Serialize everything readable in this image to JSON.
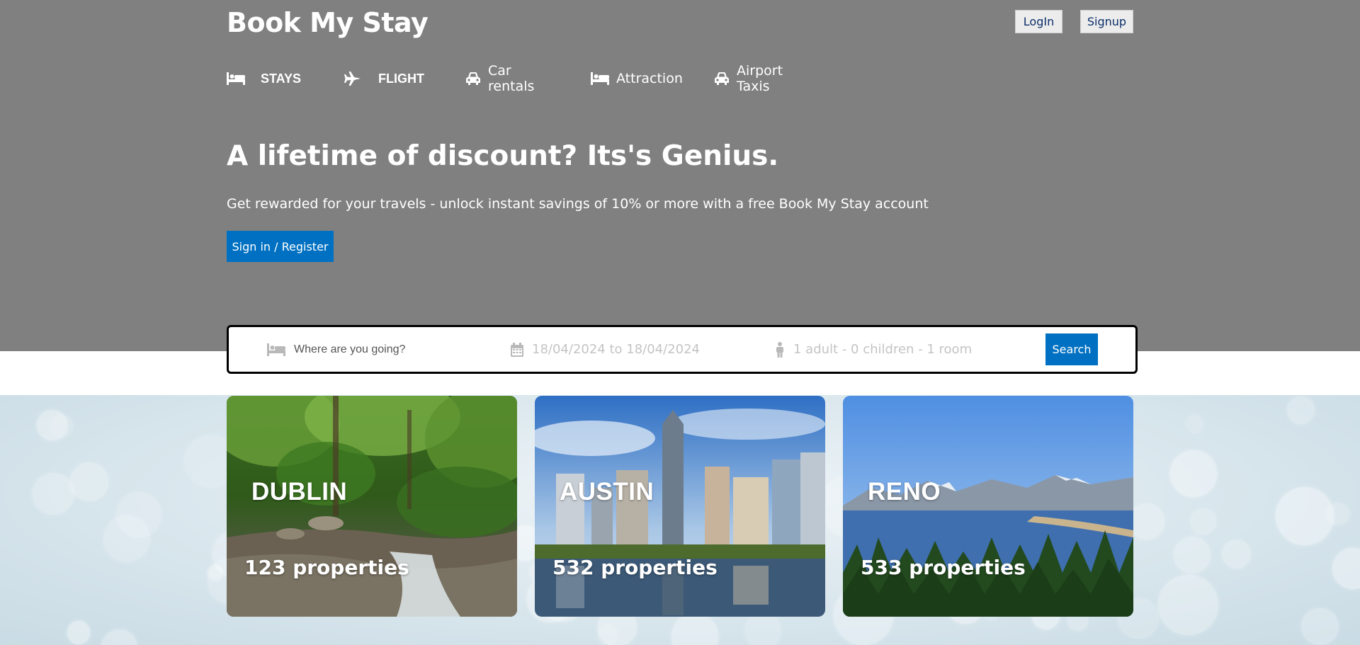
{
  "brand": {
    "name": "Book My Stay"
  },
  "auth": {
    "login_label": "LogIn",
    "signup_label": "Signup"
  },
  "nav": {
    "items": [
      {
        "label": "STAYS",
        "icon": "bed-icon"
      },
      {
        "label": "FLIGHT",
        "icon": "plane-icon"
      },
      {
        "label": "Car rentals",
        "icon": "car-icon"
      },
      {
        "label": "Attraction",
        "icon": "bed-icon"
      },
      {
        "label": "Airport Taxis",
        "icon": "taxi-icon"
      }
    ]
  },
  "hero": {
    "title": "A lifetime of discount? Its's Genius.",
    "subtitle": "Get rewarded for your travels - unlock instant savings of 10% or more with a free Book My Stay account",
    "cta_label": "Sign in / Register"
  },
  "search": {
    "destination_placeholder": "Where are you going?",
    "dates": "18/04/2024 to 18/04/2024",
    "guests": "1 adult - 0 children - 1 room",
    "button_label": "Search"
  },
  "cities": [
    {
      "name": "DUBLIN",
      "properties": "123 properties"
    },
    {
      "name": "AUSTIN",
      "properties": "532 properties"
    },
    {
      "name": "RENO",
      "properties": "533 properties"
    }
  ],
  "colors": {
    "header_bg": "#808080",
    "accent": "#0071c2",
    "auth_text": "#0b2f6a"
  }
}
